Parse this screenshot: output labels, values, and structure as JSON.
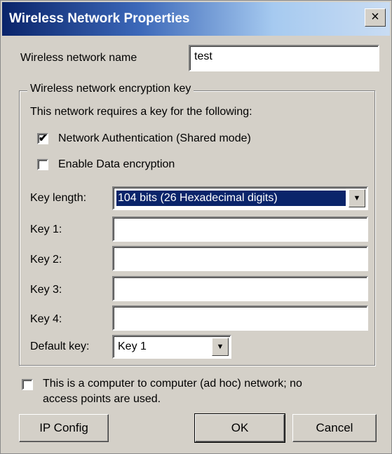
{
  "window": {
    "title": "Wireless Network Properties",
    "close_glyph": "×"
  },
  "network_name": {
    "label": "Wireless network name",
    "value": "test"
  },
  "encryption": {
    "group_label": "Wireless network encryption key",
    "requires_text": "This network requires a key for the following:",
    "network_auth": {
      "label": "Network  Authentication (Shared mode)",
      "checked": true
    },
    "data_encryption": {
      "label": "Enable Data encryption",
      "checked": false
    },
    "key_length": {
      "label": "Key length:",
      "value": "104 bits (26 Hexadecimal digits)"
    },
    "keys": [
      {
        "label": "Key 1:",
        "value": ""
      },
      {
        "label": "Key 2:",
        "value": ""
      },
      {
        "label": "Key 3:",
        "value": ""
      },
      {
        "label": "Key 4:",
        "value": ""
      }
    ],
    "default_key": {
      "label": "Default key:",
      "value": "Key 1"
    }
  },
  "adhoc": {
    "label_line1": "This is a computer to computer (ad hoc) network; no",
    "label_line2": "access points are used.",
    "checked": false
  },
  "buttons": {
    "ip_config": "IP Config",
    "ok": "OK",
    "cancel": "Cancel"
  },
  "glyphs": {
    "check": "✔",
    "arrow": "▼"
  },
  "colors": {
    "title_start": "#0a246a",
    "title_end": "#c9dcf3",
    "face": "#d4d0c8",
    "selection": "#0a246a"
  }
}
